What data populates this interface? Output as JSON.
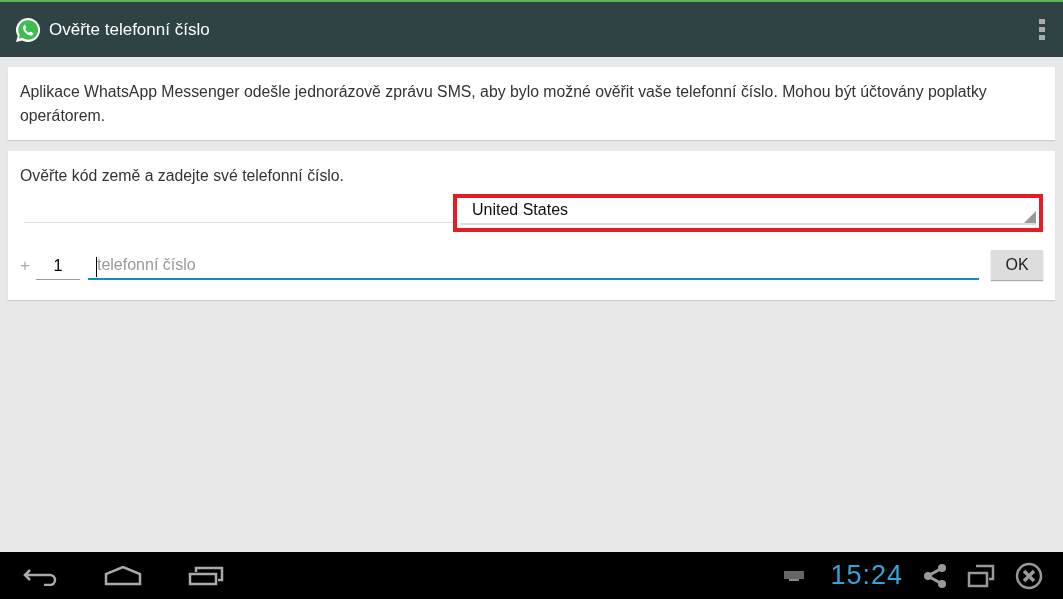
{
  "app_bar": {
    "title": "Ověřte telefonní číslo"
  },
  "notice": {
    "text": "Aplikace WhatsApp Messenger odešle jednorázově zprávu SMS, aby bylo možné ověřit vaše telefonní číslo. Mohou být účtovány poplatky operátorem."
  },
  "form": {
    "instruction": "Ověřte kód země a zadejte své telefonní číslo.",
    "country": {
      "value": "United States",
      "highlighted": true
    },
    "plus": "+",
    "country_code": "1",
    "phone": {
      "placeholder": "telefonní číslo",
      "focused": true
    },
    "ok_button": "OK"
  },
  "nav_bar": {
    "clock": "15:24"
  }
}
